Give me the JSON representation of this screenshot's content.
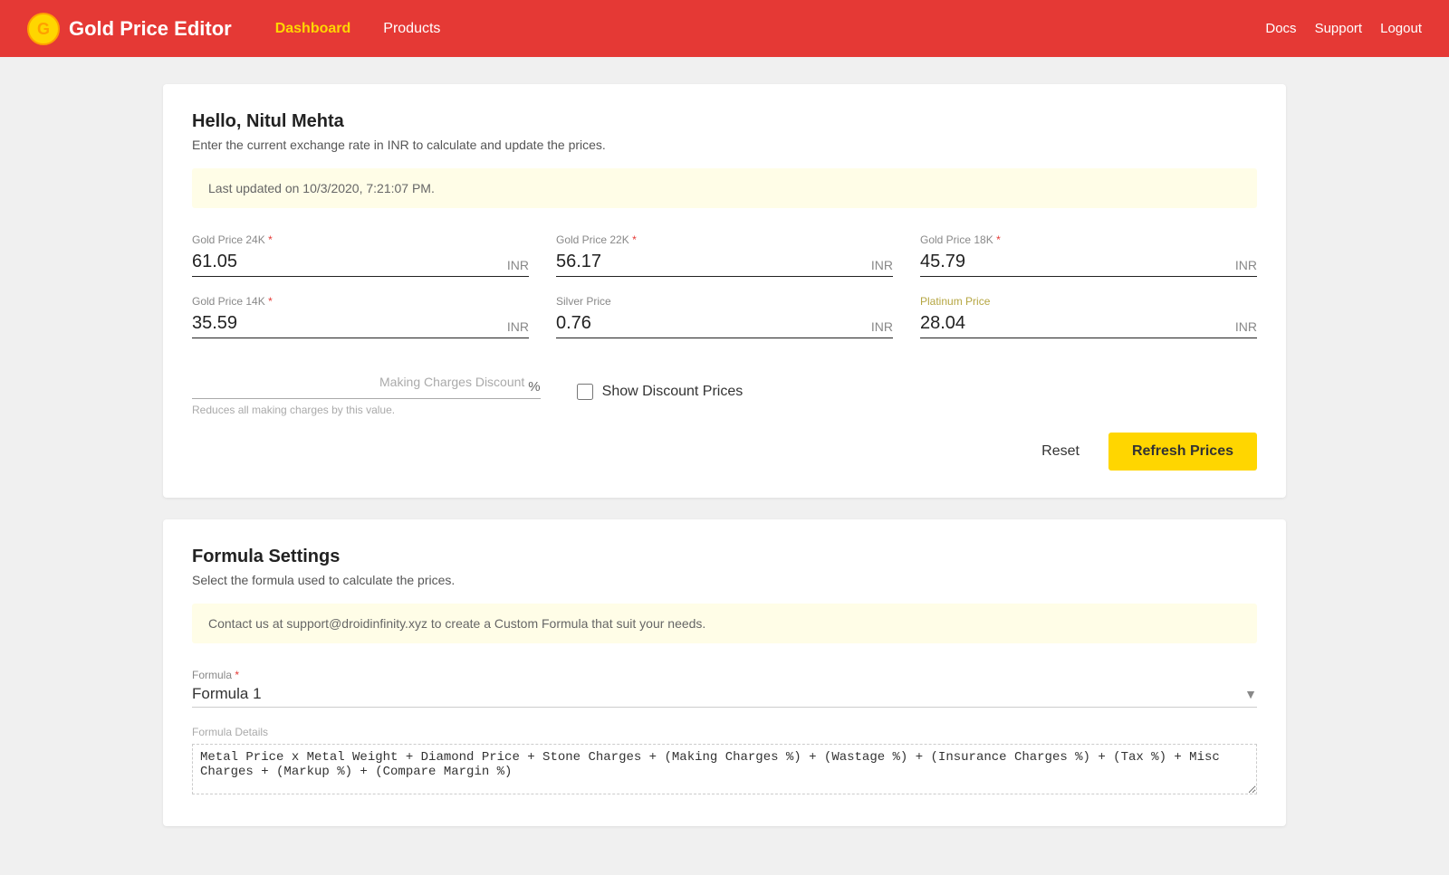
{
  "navbar": {
    "logo_alt": "Gold Price Editor Logo",
    "title": "Gold Price Editor",
    "links": [
      {
        "label": "Dashboard",
        "active": true
      },
      {
        "label": "Products",
        "active": false
      }
    ],
    "right_links": [
      "Docs",
      "Support",
      "Logout"
    ]
  },
  "price_editor": {
    "greeting": "Hello, Nitul Mehta",
    "subtitle": "Enter the current exchange rate in INR to calculate and update the prices.",
    "last_updated": "Last updated on 10/3/2020, 7:21:07 PM.",
    "fields": [
      {
        "label": "Gold Price 24K",
        "required": true,
        "value": "61.05",
        "currency": "INR"
      },
      {
        "label": "Gold Price 22K",
        "required": true,
        "value": "56.17",
        "currency": "INR"
      },
      {
        "label": "Gold Price 18K",
        "required": true,
        "value": "45.79",
        "currency": "INR"
      },
      {
        "label": "Gold Price 14K",
        "required": true,
        "value": "35.59",
        "currency": "INR"
      },
      {
        "label": "Silver Price",
        "required": false,
        "value": "0.76",
        "currency": "INR"
      },
      {
        "label": "Platinum Price",
        "required": false,
        "value": "28.04",
        "currency": "INR",
        "platinum": true
      }
    ],
    "discount_label": "Making Charges Discount",
    "discount_value": "",
    "discount_placeholder": "",
    "discount_symbol": "%",
    "discount_help": "Reduces all making charges by this value.",
    "show_discount_label": "Show Discount Prices",
    "reset_label": "Reset",
    "refresh_label": "Refresh Prices"
  },
  "formula_settings": {
    "title": "Formula Settings",
    "subtitle": "Select the formula used to calculate the prices.",
    "info": "Contact us at support@droidinfinity.xyz to create a Custom Formula that suit your needs.",
    "formula_label": "Formula",
    "formula_required": true,
    "formula_value": "Formula 1",
    "formula_details_label": "Formula Details",
    "formula_details_value": "Metal Price x Metal Weight + Diamond Price + Stone Charges + (Making Charges %) + (Wastage %) + (Insurance Charges %) + (Tax %) + Misc Charges + (Markup %) + (Compare Margin %)"
  }
}
